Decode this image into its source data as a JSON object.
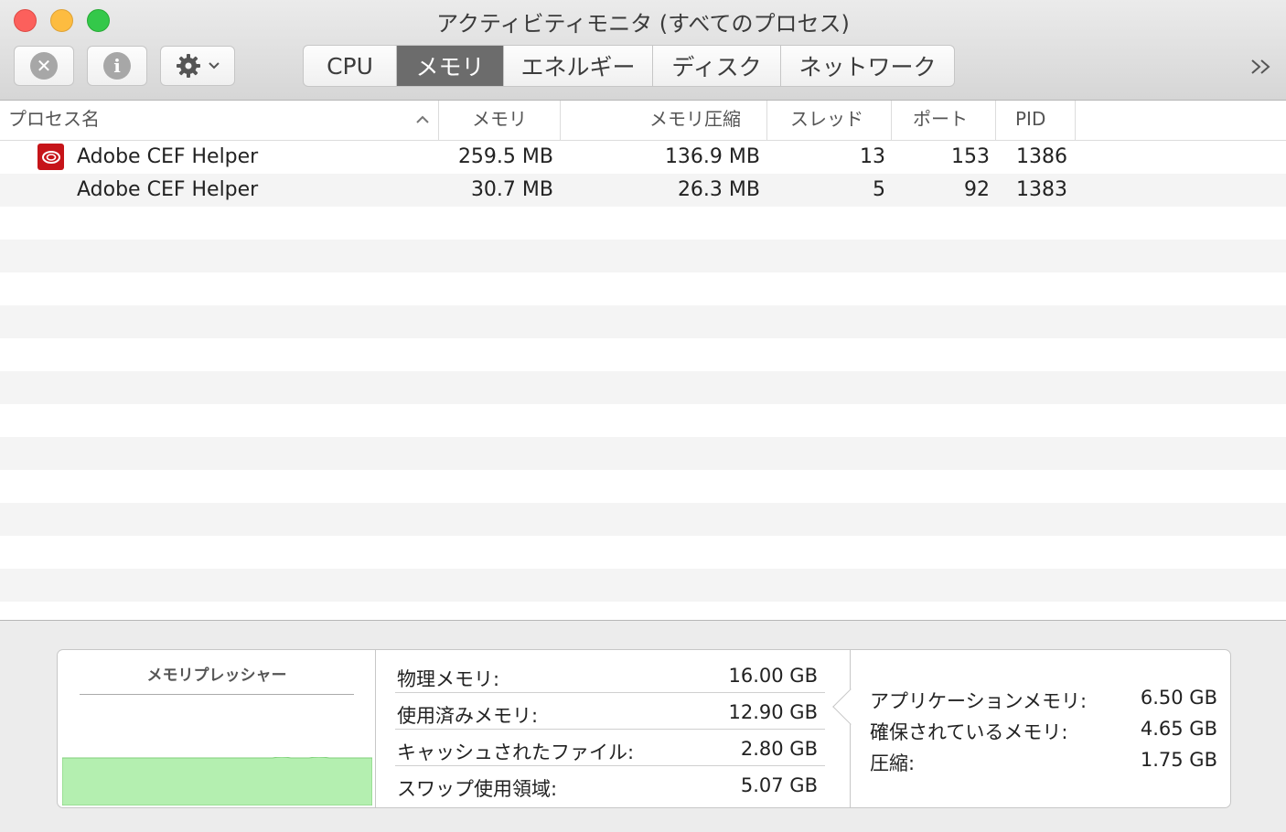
{
  "window": {
    "title": "アクティビティモニタ (すべてのプロセス)"
  },
  "toolbar": {
    "stop_icon": "x-circle-icon",
    "info_icon": "info-icon",
    "gear_icon": "gear-icon",
    "info_glyph": "i",
    "stop_glyph": "✕",
    "tabs": [
      "CPU",
      "メモリ",
      "エネルギー",
      "ディスク",
      "ネットワーク"
    ],
    "active_tab": "メモリ",
    "more_glyph": "»"
  },
  "table": {
    "columns": [
      "プロセス名",
      "メモリ",
      "メモリ圧縮",
      "スレッド",
      "ポート",
      "PID"
    ],
    "rows": [
      {
        "name": "Adobe CEF Helper",
        "memory": "259.5 MB",
        "compressed": "136.9 MB",
        "threads": "13",
        "ports": "153",
        "pid": "1386",
        "icon": "adobe-creative-cloud-icon"
      },
      {
        "name": "Adobe CEF Helper",
        "memory": "30.7 MB",
        "compressed": "26.3 MB",
        "threads": "5",
        "ports": "92",
        "pid": "1383"
      }
    ]
  },
  "footer": {
    "pressure_title": "メモリプレッシャー",
    "pressure_color": "#b4efb0",
    "left_stats": [
      {
        "label": "物理メモリ:",
        "value": "16.00 GB"
      },
      {
        "label": "使用済みメモリ:",
        "value": "12.90 GB"
      },
      {
        "label": "キャッシュされたファイル:",
        "value": "2.80 GB"
      },
      {
        "label": "スワップ使用領域:",
        "value": "5.07 GB"
      }
    ],
    "right_stats": [
      {
        "label": "アプリケーションメモリ:",
        "value": "6.50 GB"
      },
      {
        "label": "確保されているメモリ:",
        "value": "4.65 GB"
      },
      {
        "label": "圧縮:",
        "value": "1.75 GB"
      }
    ]
  }
}
